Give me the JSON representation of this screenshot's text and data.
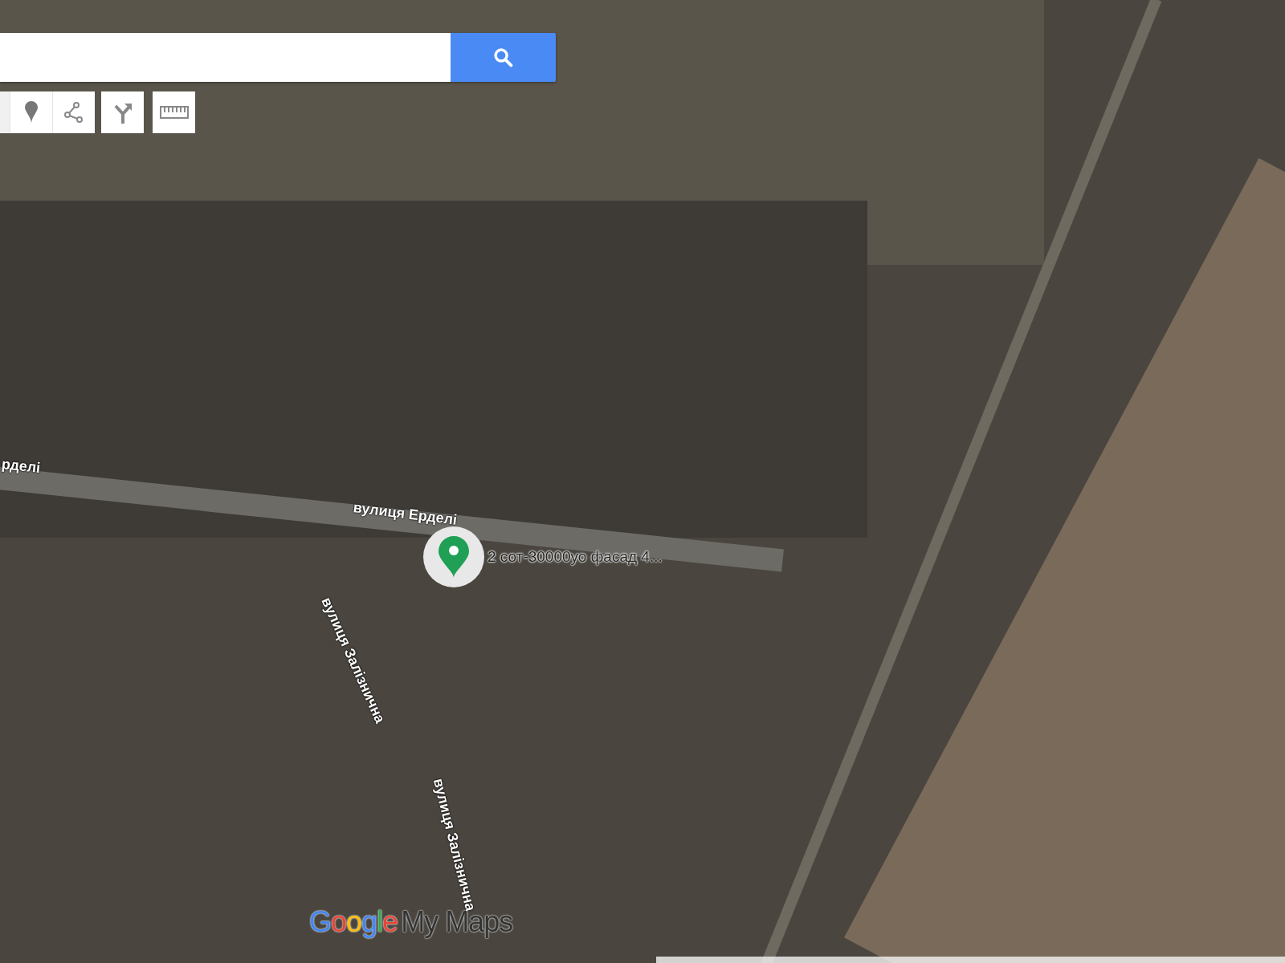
{
  "toolbar": [
    {
      "kind": "partial"
    },
    {
      "kind": "marker"
    },
    {
      "kind": "line"
    },
    {
      "kind": "directions"
    },
    {
      "kind": "ruler"
    }
  ],
  "map": {
    "streets": [
      "рделі",
      "вулиця Ерделі",
      "вулиця Залізнична",
      "вулиця Залізнична"
    ],
    "marker": {
      "label": "2 сот-30000уо фасад 4..."
    },
    "logo": {
      "brand": "Google",
      "product": "My Maps"
    }
  }
}
